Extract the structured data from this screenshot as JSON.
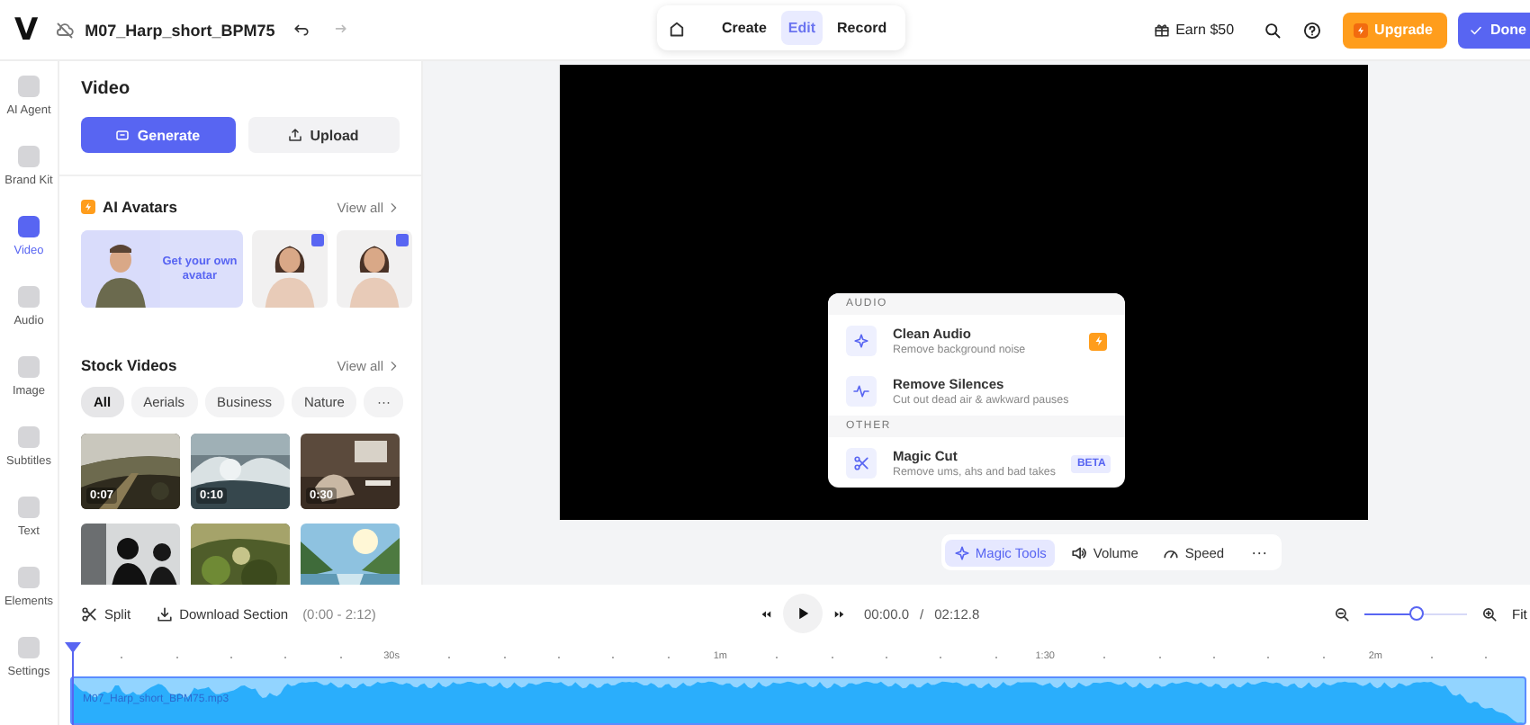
{
  "topbar": {
    "logo": "V",
    "file_name": "M07_Harp_short_BPM75",
    "modes": [
      {
        "label": "Create",
        "selected": false
      },
      {
        "label": "Edit",
        "selected": true
      },
      {
        "label": "Record",
        "selected": false
      }
    ],
    "earn": "Earn $50",
    "upgrade": "Upgrade",
    "done": "Done"
  },
  "rail": [
    {
      "label": "AI Agent",
      "selected": false
    },
    {
      "label": "Brand Kit",
      "selected": false
    },
    {
      "label": "Video",
      "selected": true
    },
    {
      "label": "Audio",
      "selected": false
    },
    {
      "label": "Image",
      "selected": false
    },
    {
      "label": "Subtitles",
      "selected": false
    },
    {
      "label": "Text",
      "selected": false
    },
    {
      "label": "Elements",
      "selected": false
    },
    {
      "label": "Settings",
      "selected": false
    }
  ],
  "panel": {
    "title": "Video",
    "generate": "Generate",
    "upload": "Upload",
    "avatars": {
      "title": "AI Avatars",
      "view_all": "View all",
      "promo": "Get your own avatar",
      "items": [
        {
          "kind": "picture"
        },
        {
          "kind": "picture"
        }
      ]
    },
    "stock": {
      "title": "Stock Videos",
      "view_all": "View all",
      "filters": [
        {
          "label": "All",
          "selected": true
        },
        {
          "label": "Aerials",
          "selected": false
        },
        {
          "label": "Business",
          "selected": false
        },
        {
          "label": "Nature",
          "selected": false
        }
      ],
      "more": "···",
      "videos": [
        {
          "kind": "picture",
          "duration": "0:07"
        },
        {
          "kind": "picture",
          "duration": "0:10"
        },
        {
          "kind": "picture",
          "duration": "0:30"
        },
        {
          "kind": "picture"
        },
        {
          "kind": "picture"
        },
        {
          "kind": "picture"
        }
      ]
    }
  },
  "menu": {
    "sections": [
      {
        "title": "AUDIO",
        "items": [
          {
            "title": "Clean Audio",
            "subtitle": "Remove background noise",
            "badge": {
              "kind": "pro"
            }
          },
          {
            "title": "Remove Silences",
            "subtitle": "Cut out dead air & awkward pauses"
          }
        ]
      },
      {
        "title": "OTHER",
        "items": [
          {
            "title": "Magic Cut",
            "subtitle": "Remove ums, ahs and bad takes",
            "badge": {
              "kind": "text",
              "text": "BETA"
            }
          }
        ]
      }
    ]
  },
  "toolbar": {
    "tools": [
      {
        "label": "Magic Tools",
        "selected": true
      },
      {
        "label": "Volume",
        "selected": false
      },
      {
        "label": "Speed",
        "selected": false
      }
    ],
    "more": "···"
  },
  "timeline": {
    "split": "Split",
    "download": "Download Section",
    "range": "(0:00 - 2:12)",
    "current_time": "00:00.0",
    "separator": "/",
    "duration": "02:12.8",
    "zoom": {
      "level": 0.5
    },
    "fit": "Fit",
    "ruler": [
      "30s",
      "1m",
      "1:30",
      "2m"
    ],
    "clip_name": "M07_Harp_short_BPM75.mp3"
  }
}
